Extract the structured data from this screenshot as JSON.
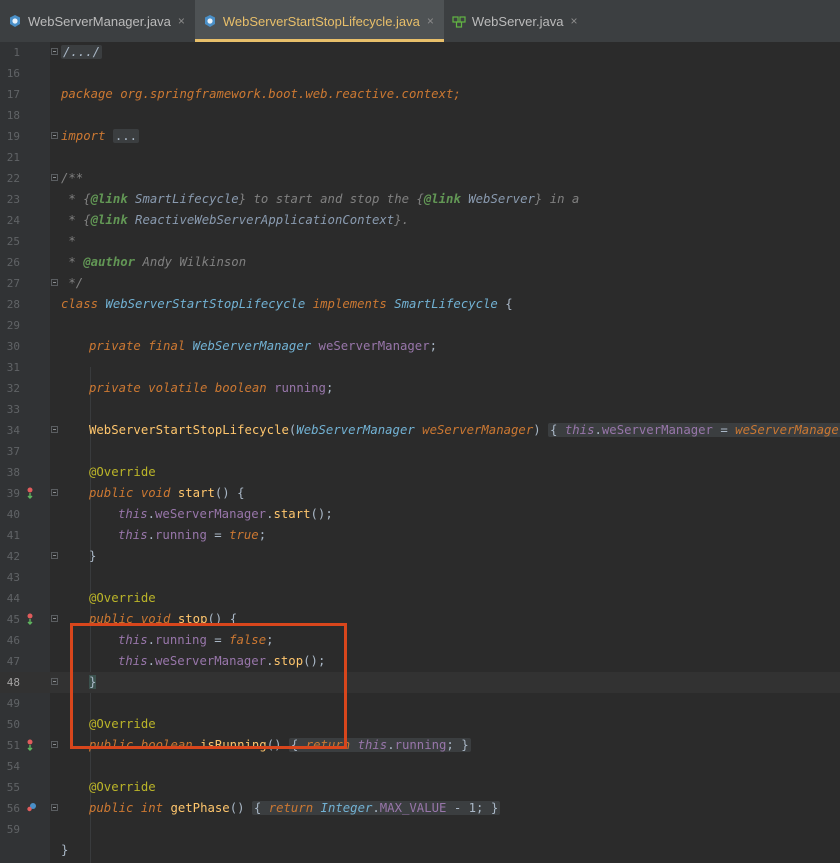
{
  "tabs": [
    {
      "label": "WebServerManager.java",
      "close": "×",
      "icon": "java-class-icon",
      "active": false
    },
    {
      "label": "WebServerStartStopLifecycle.java",
      "close": "×",
      "icon": "java-class-icon",
      "active": true
    },
    {
      "label": "WebServer.java",
      "close": "×",
      "icon": "java-interface-icon",
      "active": false
    }
  ],
  "line_numbers": [
    "1",
    "16",
    "17",
    "18",
    "19",
    "21",
    "22",
    "23",
    "24",
    "25",
    "26",
    "27",
    "28",
    "29",
    "30",
    "31",
    "32",
    "33",
    "34",
    "37",
    "38",
    "39",
    "40",
    "41",
    "42",
    "43",
    "44",
    "45",
    "46",
    "47",
    "48",
    "49",
    "50",
    "51",
    "54",
    "55",
    "56",
    "59"
  ],
  "code": {
    "header": "/.../",
    "package_kw": "package",
    "package_name": "org.springframework.boot.web.reactive.context;",
    "import_kw": "import",
    "import_fold": "...",
    "doc_open": "/**",
    "doc_l1_a": " * {",
    "link1": "@link",
    "doc_l1_b": " SmartLifecycle",
    "doc_l1_c": "} to start and stop the {",
    "link2": "@link",
    "doc_l1_d": " WebServer",
    "doc_l1_e": "} in a",
    "doc_l2_a": " * {",
    "link3": "@link",
    "doc_l2_b": " ReactiveWebServerApplicationContext",
    "doc_l2_c": "}.",
    "doc_star": " *",
    "doc_l4_a": " * ",
    "author_tag": "@author",
    "author_name": " Andy Wilkinson",
    "doc_close": " */",
    "class_kw": "class",
    "class_name": "WebServerStartStopLifecycle",
    "implements_kw": "implements",
    "iface_name": "SmartLifecycle",
    "brace_open": " {",
    "private_kw": "private",
    "final_kw": "final",
    "manager_type": "WebServerManager",
    "manager_field": "weServerManager",
    "semi": ";",
    "volatile_kw": "volatile",
    "boolean_kw": "boolean",
    "running_field": "running",
    "ctor_name": "WebServerStartStopLifecycle",
    "paren_open": "(",
    "ctor_param": "weServerManager",
    "paren_close": ")",
    "this_kw": "this",
    "dot": ".",
    "assign": " = ",
    "override": "@Override",
    "public_kw": "public",
    "void_kw": "void",
    "start_name": "start",
    "stop_name": "stop",
    "call_parens": "()",
    "brace_close": "}",
    "true_kw": "true",
    "false_kw": "false",
    "is_running_name": "isRunning",
    "return_kw": "return",
    "int_kw": "int",
    "get_phase_name": "getPhase",
    "integer_type": "Integer",
    "max_value": "MAX_VALUE",
    "minus_one": " - 1;",
    "open_block": "{ ",
    "close_block": " }"
  },
  "colors": {
    "background": "#2b2b2b",
    "keyword": "#cc7832",
    "annotation": "#bbb529",
    "method": "#ffc66d",
    "field": "#9876aa",
    "comment": "#808080",
    "highlight_box": "#d8461c",
    "active_tab": "#e8bf6a"
  }
}
